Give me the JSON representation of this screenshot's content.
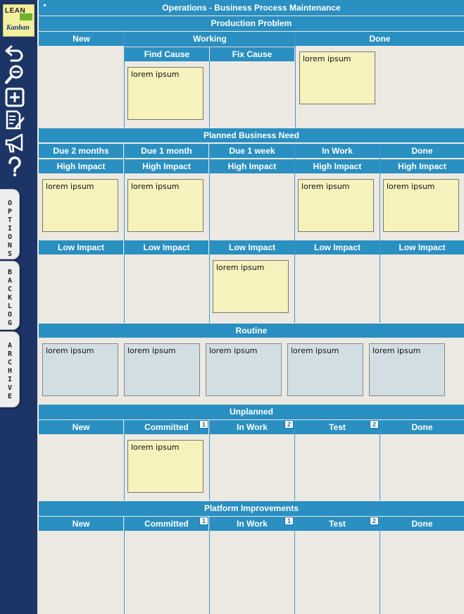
{
  "app": {
    "title": "Operations - Business Process Maintenance"
  },
  "logo": {
    "line1": "LEAN",
    "line2": "Kanban"
  },
  "toolbar": [
    "undo-icon",
    "zoom-icon",
    "add-icon",
    "edit-icon",
    "announce-icon",
    "help-icon"
  ],
  "side_tabs": {
    "options": "O\nP\nT\nI\nO\nN\nS",
    "backlog": "B\nA\nC\nK\nL\nO\nG",
    "archive": "A\nR\nC\nH\nI\nV\nE"
  },
  "card_text": "lorem ipsum",
  "lanes": {
    "production": {
      "title": "Production Problem",
      "new": "New",
      "working": "Working",
      "done": "Done",
      "find_cause": "Find Cause",
      "fix_cause": "Fix Cause"
    },
    "planned": {
      "title": "Planned Business Need",
      "columns": [
        "Due 2 months",
        "Due 1 month",
        "Due 1 week",
        "In Work",
        "Done"
      ],
      "high": "High Impact",
      "low": "Low Impact"
    },
    "routine": {
      "title": "Routine"
    },
    "unplanned": {
      "title": "Unplanned",
      "columns": [
        "New",
        "Committed",
        "In Work",
        "Test",
        "Done"
      ],
      "wip": [
        "1",
        "2",
        "2"
      ]
    },
    "platform": {
      "title": "Platform Improvements",
      "columns": [
        "New",
        "Committed",
        "In Work",
        "Test",
        "Done"
      ],
      "wip": [
        "1",
        "1",
        "2"
      ]
    }
  },
  "colors": {
    "header": "#2a8fc1",
    "sidebar": "#1c3566",
    "card": "#f6f2bd",
    "card_routine": "#d2dee2",
    "background": "#ece9e2"
  }
}
